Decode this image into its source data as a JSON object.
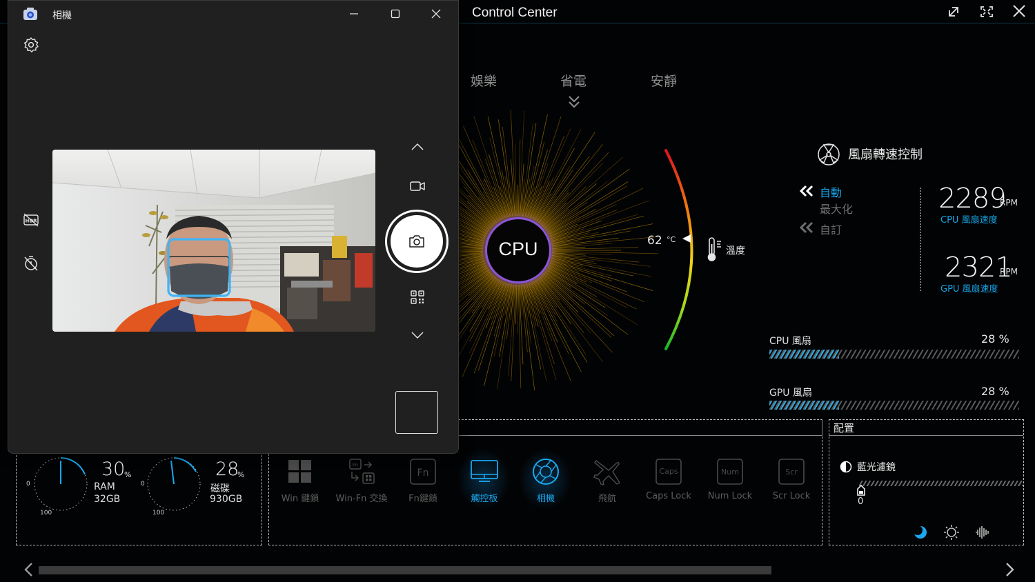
{
  "control_center": {
    "title": "Control Center",
    "modes": [
      "娛樂",
      "省電",
      "安靜"
    ],
    "cpu_label": "CPU",
    "temperature": {
      "value": "62",
      "unit": "°C",
      "label": "溫度"
    },
    "fan_control": {
      "title": "風扇轉速控制",
      "options": [
        "自動",
        "最大化",
        "自訂"
      ],
      "cpu_rpm": "2289",
      "gpu_rpm": "2321",
      "rpm_unit": "RPM",
      "cpu_rpm_label": "CPU 風扇速度",
      "gpu_rpm_label": "GPU 風扇速度"
    },
    "fans": [
      {
        "label": "CPU 風扇",
        "percent": "28 %",
        "level": 0.28
      },
      {
        "label": "GPU 風扇",
        "percent": "28 %",
        "level": 0.28
      }
    ],
    "resources": [
      {
        "percent": "30",
        "unit": "%",
        "name": "RAM",
        "size": "32GB",
        "tick_min": "0",
        "tick_max": "100"
      },
      {
        "percent": "28",
        "unit": "%",
        "name": "磁碟",
        "size": "930GB",
        "tick_min": "0",
        "tick_max": "100"
      }
    ],
    "hotkeys": [
      {
        "label": "Win 鍵鎖",
        "icon": "windows-icon",
        "active": false
      },
      {
        "label": "Win-Fn 交換",
        "icon": "fn-swap-icon",
        "active": false,
        "glyph": "Fn"
      },
      {
        "label": "Fn鍵鎖",
        "icon": "fn-lock-icon",
        "active": false,
        "glyph": "Fn"
      },
      {
        "label": "觸控板",
        "icon": "touchpad-icon",
        "active": true
      },
      {
        "label": "相機",
        "icon": "camera-shutter-icon",
        "active": true
      },
      {
        "label": "飛航",
        "icon": "airplane-icon",
        "active": false
      },
      {
        "label": "Caps Lock",
        "icon": "caps-lock-icon",
        "active": false,
        "glyph": "Caps"
      },
      {
        "label": "Num Lock",
        "icon": "num-lock-icon",
        "active": false,
        "glyph": "Num"
      },
      {
        "label": "Scr Lock",
        "icon": "scroll-lock-icon",
        "active": false,
        "glyph": "Scr"
      }
    ],
    "config": {
      "title": "配置",
      "blue_light_label": "藍光濾鏡",
      "blue_light_value": "0"
    },
    "colors": {
      "accent": "#16a4e6",
      "hatch": "#5a5a5a",
      "hatch_fill": "#2aa9e2"
    }
  },
  "camera": {
    "title": "相機",
    "icons": {
      "settings": "gear-icon",
      "hdr": "hdr-off-icon",
      "timer": "timer-off-icon",
      "up": "chevron-up-icon",
      "video": "video-mode-icon",
      "photo": "camera-icon",
      "qr": "qr-code-icon",
      "down": "chevron-down-icon"
    }
  }
}
